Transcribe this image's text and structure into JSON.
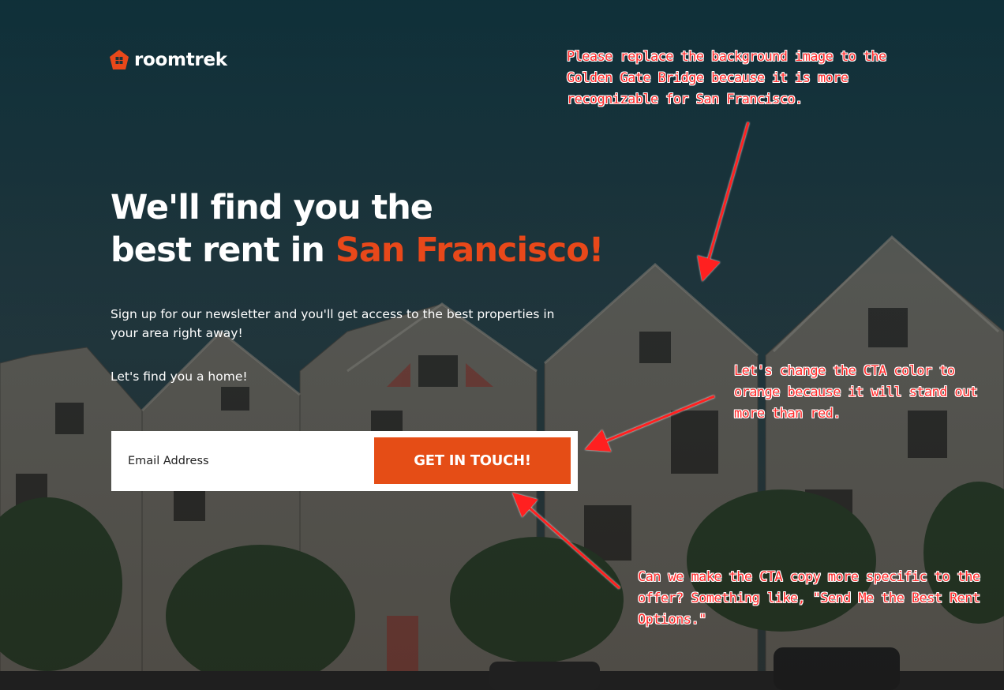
{
  "logo": {
    "text": "roomtrek",
    "icon": "house-pentagon-icon"
  },
  "hero": {
    "title_line1": "We'll find you the",
    "title_line2_prefix": "best rent in ",
    "title_line2_accent": "San Francisco!",
    "subtitle": "Sign up for our newsletter and you'll get access to the best properties in your area right away!",
    "find_home": "Let's find you a home!"
  },
  "form": {
    "email_placeholder": "Email Address",
    "cta_label": "GET IN TOUCH!"
  },
  "annotations": {
    "note1": "Please replace the background image to the Golden Gate Bridge because it is more recognizable for San Francisco.",
    "note2": "Let's change the CTA color to orange because it will stand out more than red.",
    "note3": "Can we make the CTA copy more specific to the offer? Something like, \"Send Me the Best Rent Options.\""
  },
  "colors": {
    "accent": "#e8481a",
    "cta": "#e54d16",
    "annotation": "#ff2a2a",
    "sky": "#1c3238"
  }
}
